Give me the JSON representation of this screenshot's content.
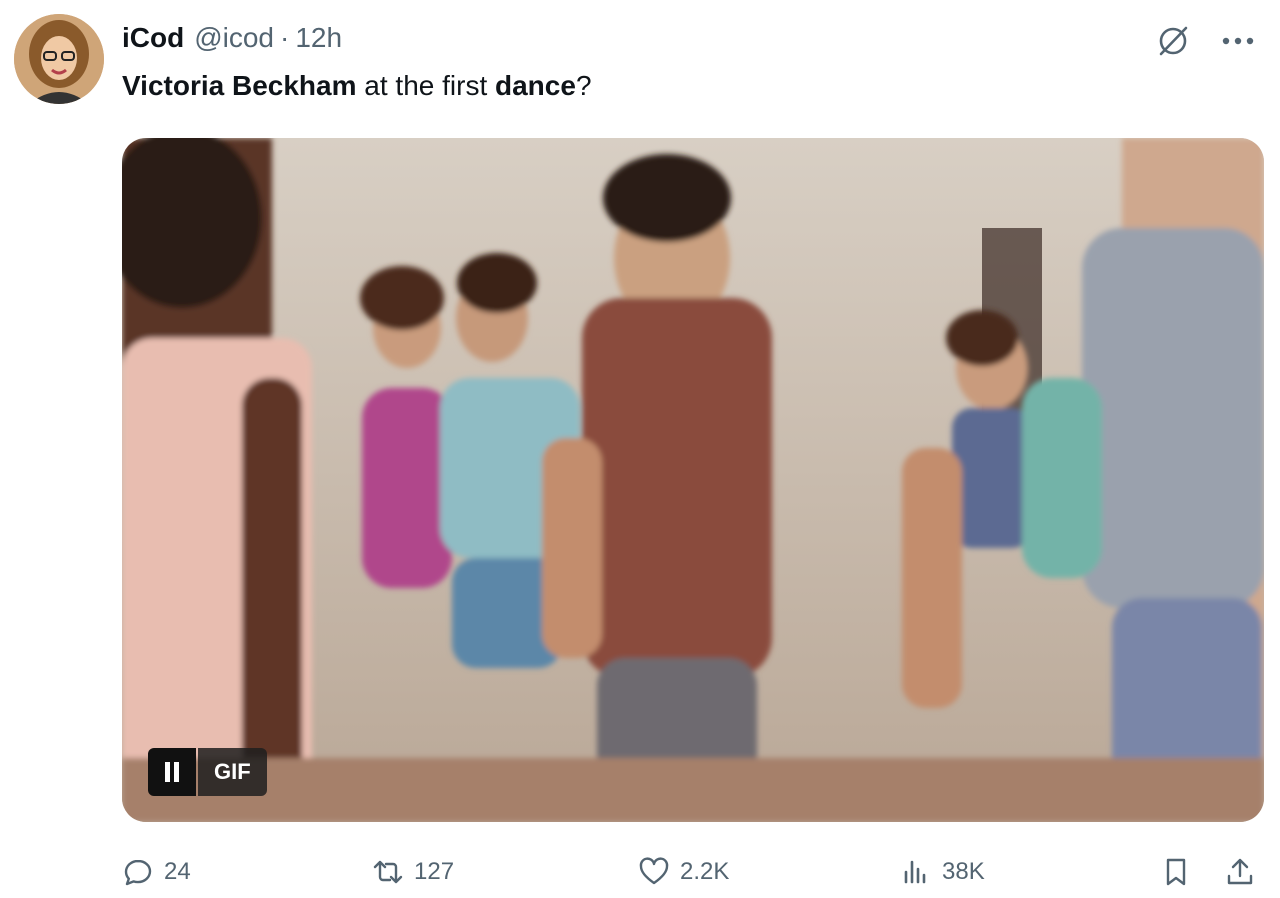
{
  "tweet": {
    "author_name": "iCod",
    "handle": "@icod",
    "separator": "·",
    "time": "12h",
    "text_parts": {
      "bold1": "Victoria Beckham",
      "plain1": " at the first ",
      "bold2": "dance",
      "plain2": "?"
    },
    "media": {
      "badge": "GIF",
      "pause_icon": "pause-icon"
    },
    "actions": {
      "replies": "24",
      "retweets": "127",
      "likes": "2.2K",
      "views": "38K"
    },
    "icons": [
      "grok-icon",
      "more-icon",
      "reply-icon",
      "retweet-icon",
      "heart-icon",
      "views-icon",
      "bookmark-icon",
      "share-icon"
    ]
  },
  "colors": {
    "text": "#0f1419",
    "secondary": "#536471"
  }
}
